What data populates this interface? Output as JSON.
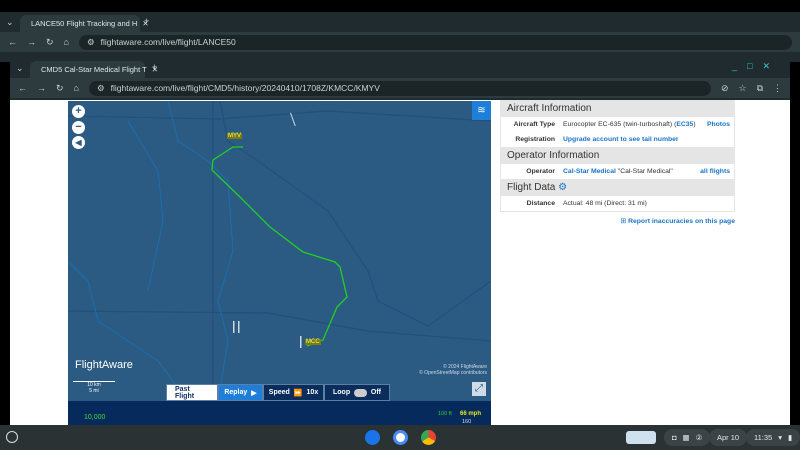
{
  "back_window": {
    "tab_title": "LANCE50 Flight Tracking and H",
    "url": "flightaware.com/live/flight/LANCE50"
  },
  "front_window": {
    "tab_title": "CMD5 Cal-Star Medical Flight T",
    "url": "flightaware.com/live/flight/CMD5/history/20240410/1708Z/KMCC/KMYV"
  },
  "map": {
    "airport_origin": "MCC",
    "airport_destination": "MYV",
    "logo": "FlightAware",
    "scale_km": "10 km",
    "scale_mi": "5 mi",
    "copyright": "© 2024 FlightAware",
    "osm": "© OpenStreetMap contributors",
    "route_color": "#22d022"
  },
  "controls": {
    "past_flight": "Past Flight",
    "replay": "Replay",
    "speed_label": "Speed",
    "speed_value": "10x",
    "loop_label": "Loop",
    "loop_value": "Off"
  },
  "chart": {
    "alt_label": "100 ft",
    "speed_label": "66 mph",
    "y_tick": "10,000",
    "speed_tick": "160"
  },
  "panel": {
    "aircraft_header": "Aircraft Information",
    "aircraft_type_label": "Aircraft Type",
    "aircraft_type": "Eurocopter EC-635 (twin-turboshaft) (",
    "aircraft_code": "EC35",
    "aircraft_type_end": ")",
    "photos": "Photos",
    "registration_label": "Registration",
    "registration_value": "Upgrade account to see tail number",
    "operator_header": "Operator Information",
    "operator_label": "Operator",
    "operator_link": "Cal-Star Medical",
    "operator_name": "\"Cal-Star Medical\"",
    "all_flights": "all flights",
    "flight_data_header": "Flight Data",
    "distance_label": "Distance",
    "distance_value": "Actual: 48 mi (Direct: 31 mi)",
    "report": "Report inaccuracies on this page"
  },
  "taskbar": {
    "date": "Apr 10",
    "time": "11:35"
  }
}
